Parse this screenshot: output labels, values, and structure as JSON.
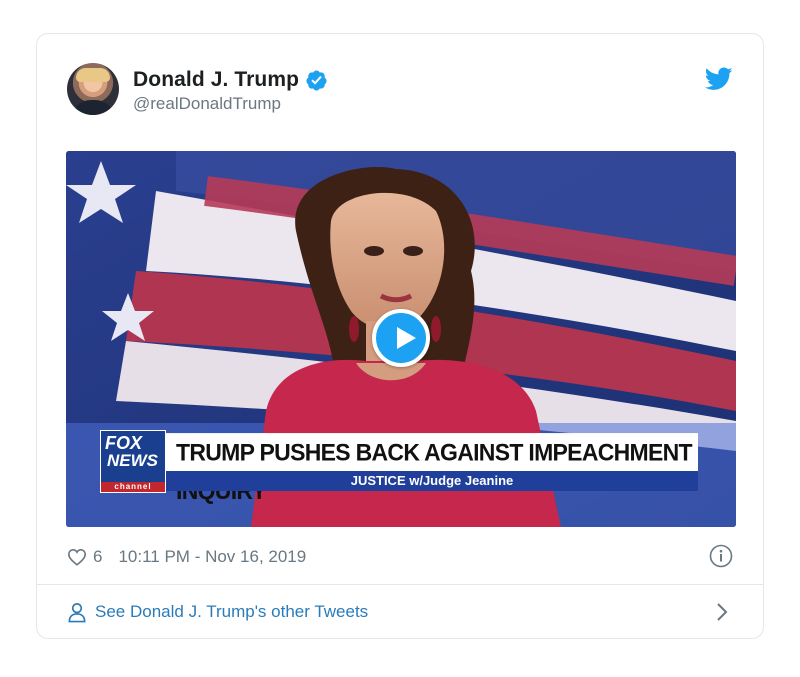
{
  "tweet": {
    "author": {
      "name": "Donald J. Trump",
      "handle": "@realDonaldTrump",
      "verified": true
    },
    "media": {
      "type": "video",
      "headline": "TRUMP PUSHES BACK AGAINST IMPEACHMENT INQUIRY",
      "subline": "JUSTICE w/Judge Jeanine",
      "logo_fox": "FOX",
      "logo_news": "NEWS",
      "logo_channel": "channel"
    },
    "likes": "6",
    "timestamp": "10:11 PM - Nov 16, 2019"
  },
  "footer": {
    "link_label": "See Donald J. Trump's other Tweets"
  },
  "icons": {
    "verified": "verified-badge-icon",
    "brand": "twitter-bird-icon",
    "like": "heart-icon",
    "info": "info-icon",
    "person": "person-icon",
    "chevron": "chevron-right-icon",
    "play": "play-icon"
  },
  "colors": {
    "twitter_blue": "#1da1f2",
    "link": "#2b7bb9",
    "muted": "#697882",
    "border": "#e1e8ed"
  }
}
